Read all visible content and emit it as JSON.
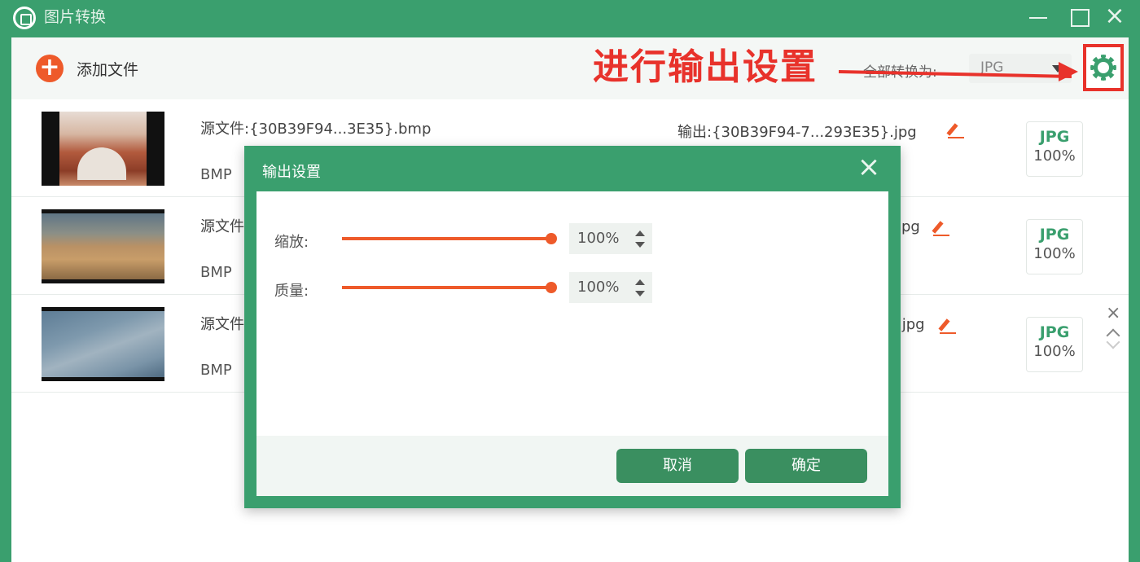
{
  "titlebar": {
    "title": "图片转换"
  },
  "toolbar": {
    "add_label": "添加文件",
    "annotation": "进行输出设置",
    "convert_all_label": "全部转换为:",
    "convert_all_value": "JPG"
  },
  "files": [
    {
      "source": "源文件:{30B39F94...3E35}.bmp",
      "format": "BMP",
      "output": "输出:{30B39F94-7...293E35}.jpg",
      "target_format": "JPG",
      "target_quality": "100%"
    },
    {
      "source": "源文件",
      "format": "BMP",
      "output": "jpg",
      "target_format": "JPG",
      "target_quality": "100%"
    },
    {
      "source": "源文件",
      "format": "BMP",
      "output": ".jpg",
      "target_format": "JPG",
      "target_quality": "100%"
    }
  ],
  "dialog": {
    "title": "输出设置",
    "scale_label": "缩放:",
    "scale_value": "100%",
    "quality_label": "质量:",
    "quality_value": "100%",
    "cancel_label": "取消",
    "ok_label": "确定"
  },
  "colors": {
    "brand": "#3a9f6e",
    "accent": "#ee5a2a",
    "annotation": "#e8322b"
  }
}
